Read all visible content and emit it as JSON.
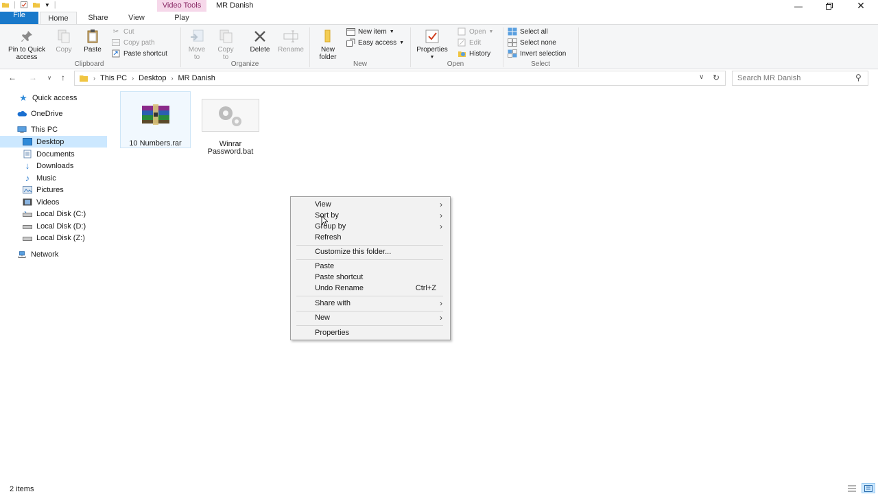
{
  "window": {
    "title": "MR Danish",
    "context_tab": "Video Tools",
    "buttons": [
      "minimize",
      "restore",
      "close"
    ]
  },
  "tabs": [
    "File",
    "Home",
    "Share",
    "View",
    "Play"
  ],
  "ribbon": {
    "clipboard": {
      "pin": "Pin to Quick access",
      "copy": "Copy",
      "paste": "Paste",
      "cut": "Cut",
      "copy_path": "Copy path",
      "paste_shortcut": "Paste shortcut",
      "group": "Clipboard"
    },
    "organize": {
      "move_to": "Move to",
      "copy_to": "Copy to",
      "delete": "Delete",
      "rename": "Rename",
      "group": "Organize"
    },
    "new": {
      "new_folder": "New folder",
      "new_item": "New item",
      "easy_access": "Easy access",
      "group": "New"
    },
    "open": {
      "properties": "Properties",
      "open": "Open",
      "edit": "Edit",
      "history": "History",
      "group": "Open"
    },
    "select": {
      "select_all": "Select all",
      "select_none": "Select none",
      "invert": "Invert selection",
      "group": "Select"
    }
  },
  "address": {
    "crumbs": [
      "This PC",
      "Desktop",
      "MR Danish"
    ],
    "search_placeholder": "Search MR Danish"
  },
  "nav": [
    {
      "label": "Quick access",
      "icon": "star-icon"
    },
    {
      "label": "OneDrive",
      "icon": "cloud-icon"
    },
    {
      "label": "This PC",
      "icon": "computer-icon"
    },
    {
      "label": "Desktop",
      "icon": "desktop-icon"
    },
    {
      "label": "Documents",
      "icon": "documents-icon"
    },
    {
      "label": "Downloads",
      "icon": "download-icon"
    },
    {
      "label": "Music",
      "icon": "music-icon"
    },
    {
      "label": "Pictures",
      "icon": "pictures-icon"
    },
    {
      "label": "Videos",
      "icon": "videos-icon"
    },
    {
      "label": "Local Disk (C:)",
      "icon": "disk-icon"
    },
    {
      "label": "Local Disk (D:)",
      "icon": "disk-icon"
    },
    {
      "label": "Local Disk (Z:)",
      "icon": "disk-icon"
    },
    {
      "label": "Network",
      "icon": "network-icon"
    }
  ],
  "files": [
    {
      "name": "10 Numbers.rar",
      "icon": "winrar-archive-icon"
    },
    {
      "name1": "Winrar",
      "name2": "Password.bat",
      "icon": "batch-file-gears-icon"
    }
  ],
  "context_menu": {
    "view": "View",
    "sort_by": "Sort by",
    "group_by": "Group by",
    "refresh": "Refresh",
    "customize": "Customize this folder...",
    "paste": "Paste",
    "paste_shortcut": "Paste shortcut",
    "undo_rename": "Undo Rename",
    "undo_shortcut": "Ctrl+Z",
    "share_with": "Share with",
    "new": "New",
    "properties": "Properties"
  },
  "status": {
    "count": "2 items"
  }
}
